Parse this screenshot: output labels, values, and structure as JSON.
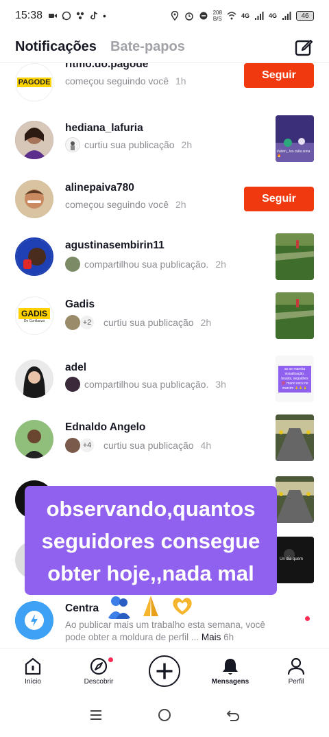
{
  "status": {
    "time": "15:38",
    "net_speed": "208",
    "net_unit": "B/S",
    "signal1": "4G",
    "signal2": "4G",
    "battery": "46"
  },
  "header": {
    "tab_notifications": "Notificações",
    "tab_chats": "Bate-papos"
  },
  "notifications": [
    {
      "name": "ritmo.do.pagode",
      "action": "começou seguindo você",
      "time": "1h",
      "button": "Seguir",
      "avatar_text": "PAGODE"
    },
    {
      "name": "hediana_lafuria",
      "action": "curtiu sua publicação",
      "time": "2h",
      "thumb_text": "#ubirn_ los culla sona 🔥"
    },
    {
      "name": "alinepaiva780",
      "action": "começou seguindo você",
      "time": "2h",
      "button": "Seguir"
    },
    {
      "name": "agustinasembirin11",
      "action": "compartilhou sua publicação.",
      "time": "2h"
    },
    {
      "name": "Gadis",
      "action": "curtiu sua publicação",
      "time": "2h",
      "extra": "+2",
      "avatar_text": "GADIS",
      "avatar_sub": "De Confianza"
    },
    {
      "name": "adel",
      "action": "compartilhou sua publicação.",
      "time": "3h",
      "thumb_text": "ao se mamba visualização, boasts, seguidres 💯 mano escu no marcim 🙏🙏🙏"
    },
    {
      "name": "Ednaldo Angelo",
      "action": "curtiu sua publicação",
      "time": "4h",
      "extra": "+4"
    },
    {
      "name": "",
      "action": "",
      "time": ""
    },
    {
      "name": "",
      "action": "",
      "time": "",
      "thumb_text": "Un dia quem"
    },
    {
      "name": "Centra",
      "action": "Ao publicar mais um trabalho esta semana, você pode obter a moldura de perfil ...",
      "more": "Mais",
      "time": "6h"
    }
  ],
  "caption": {
    "text": "observando,quantos seguidores consegue obter hoje,,nada mal"
  },
  "nav": {
    "home": "Início",
    "discover": "Descobrir",
    "inbox": "Mensagens",
    "profile": "Perfil"
  },
  "colors": {
    "follow": "#f0390f",
    "caption_bg": "#9061ee",
    "dot": "#fe2c55"
  }
}
